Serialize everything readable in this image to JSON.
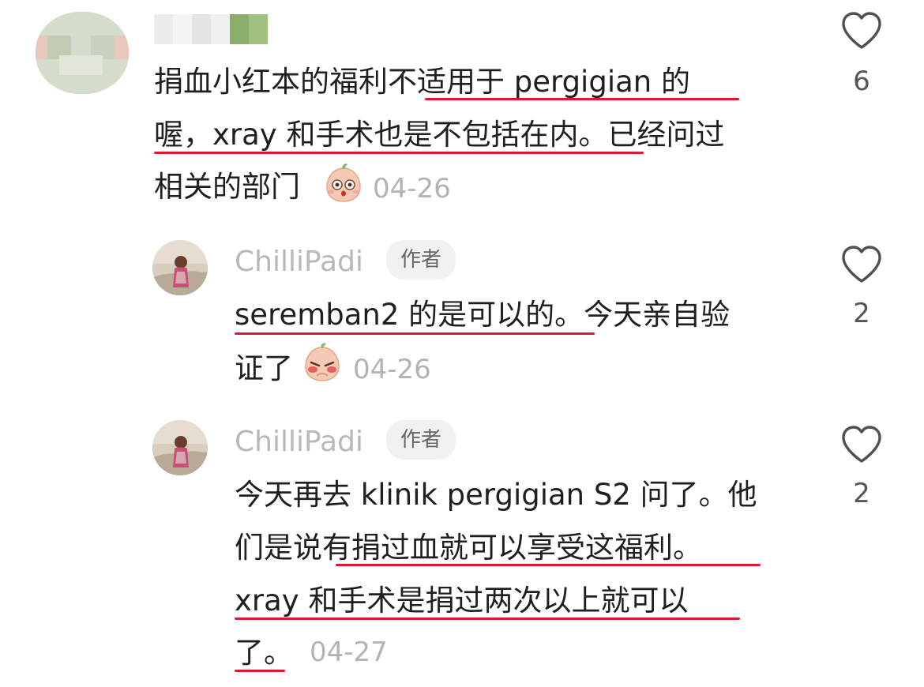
{
  "comments": [
    {
      "username": "",
      "lines": [
        "捐血小红本的福利不适用于 pergigian 的",
        "喔，xray 和手术也是不包括在内。已经问过",
        "相关的部门"
      ],
      "date": "04-26",
      "likes": "6",
      "emoji": "peach-emoji-shocked"
    },
    {
      "username": "ChilliPadi",
      "author_tag": "作者",
      "lines": [
        "seremban2 的是可以的。今天亲自验",
        "证了"
      ],
      "date": "04-26",
      "likes": "2",
      "emoji": "peach-emoji-pleading"
    },
    {
      "username": "ChilliPadi",
      "author_tag": "作者",
      "lines": [
        "今天再去 klinik pergigian S2 问了。他",
        "们是说有捐过血就可以享受这福利。",
        "xray 和手术是捐过两次以上就可以",
        "了。"
      ],
      "date": "04-27",
      "likes": "2"
    }
  ],
  "colors": {
    "underline": "#e0182d",
    "meta_text": "#b3b3b3",
    "tag_bg": "#f1f1f1"
  }
}
